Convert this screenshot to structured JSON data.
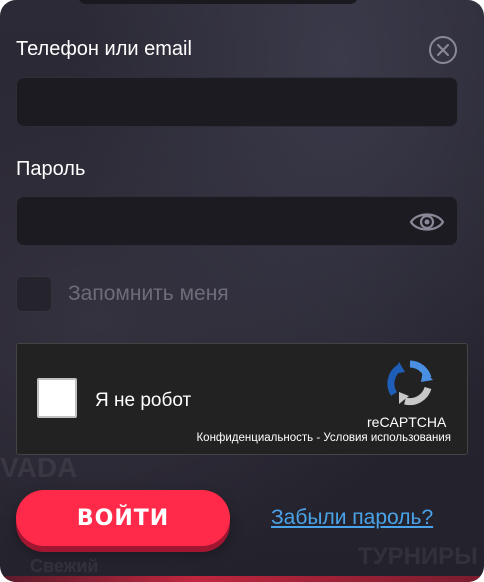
{
  "form": {
    "phone_label": "Телефон или email",
    "phone_value": "",
    "phone_placeholder": "",
    "password_label": "Пароль",
    "password_value": "",
    "password_placeholder": "",
    "remember_label": "Запомнить меня",
    "remember_checked": false,
    "submit_label": "ВОЙТИ",
    "forgot_label": "Забыли пароль?"
  },
  "recaptcha": {
    "label": "Я не робот",
    "brand": "reCAPTCHA",
    "privacy_link": "Конфиденциальность",
    "separator": " - ",
    "terms_link": "Условия использования",
    "checked": false
  },
  "background": {
    "text_left": "VADA",
    "text_right": "ТУРНИРЫ",
    "text_bottom": "Свежий"
  },
  "icons": {
    "close": "close-circle-icon",
    "eye": "eye-icon",
    "recaptcha_logo": "recaptcha-logo-icon"
  },
  "colors": {
    "accent": "#ff2a4a",
    "link": "#4aa3e8",
    "panel_bg": "#2a2833",
    "input_bg": "#1c1b22"
  }
}
